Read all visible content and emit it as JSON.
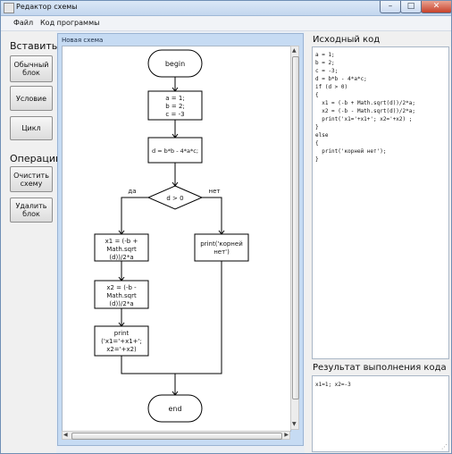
{
  "window": {
    "title": "Редактор схемы",
    "minimize": "–",
    "maximize": "□",
    "close": "✕"
  },
  "menu": [
    "Файл",
    "Код программы"
  ],
  "left_panel": {
    "insert_label": "Вставить",
    "insert_buttons": [
      "Обычный\nблок",
      "Условие",
      "Цикл"
    ],
    "ops_label": "Операции",
    "ops_buttons": [
      "Очистить\nсхему",
      "Удалить\nблок"
    ]
  },
  "canvas": {
    "tab_label": "Новая схема",
    "flowchart": {
      "begin": "begin",
      "assign": [
        "a = 1;",
        "b = 2;",
        "c = -3"
      ],
      "discriminant": "d = b*b - 4*a*c;",
      "condition": "d > 0",
      "yes": "да",
      "no": "нет",
      "x1": [
        "x1 = (-b +",
        "Math.sqrt",
        "(d))/2*a"
      ],
      "x2": [
        "x2 = (-b -",
        "Math.sqrt",
        "(d))/2*a"
      ],
      "print_roots": [
        "print",
        "('x1='+x1+';",
        "x2='+x2)"
      ],
      "print_none": [
        "print('корней",
        "нет')"
      ],
      "end": "end"
    }
  },
  "right_panel": {
    "source_title": "Исходный код",
    "source_code": [
      "a = 1;",
      "b = 2;",
      "c = -3;",
      "d = b*b - 4*a*c;",
      "if (d > 0)",
      "{",
      "  x1 = (-b + Math.sqrt(d))/2*a;",
      "  x2 = (-b - Math.sqrt(d))/2*a;",
      "  print('x1='+x1+'; x2='+x2) ;",
      "}",
      "else",
      "{",
      "  print('корней нет');",
      "}"
    ],
    "result_title": "Результат выполнения кода",
    "result_text": "x1=1; x2=-3"
  },
  "colors": {
    "canvas_frame": "#c6dbf3",
    "close_button": "#c7412a"
  }
}
